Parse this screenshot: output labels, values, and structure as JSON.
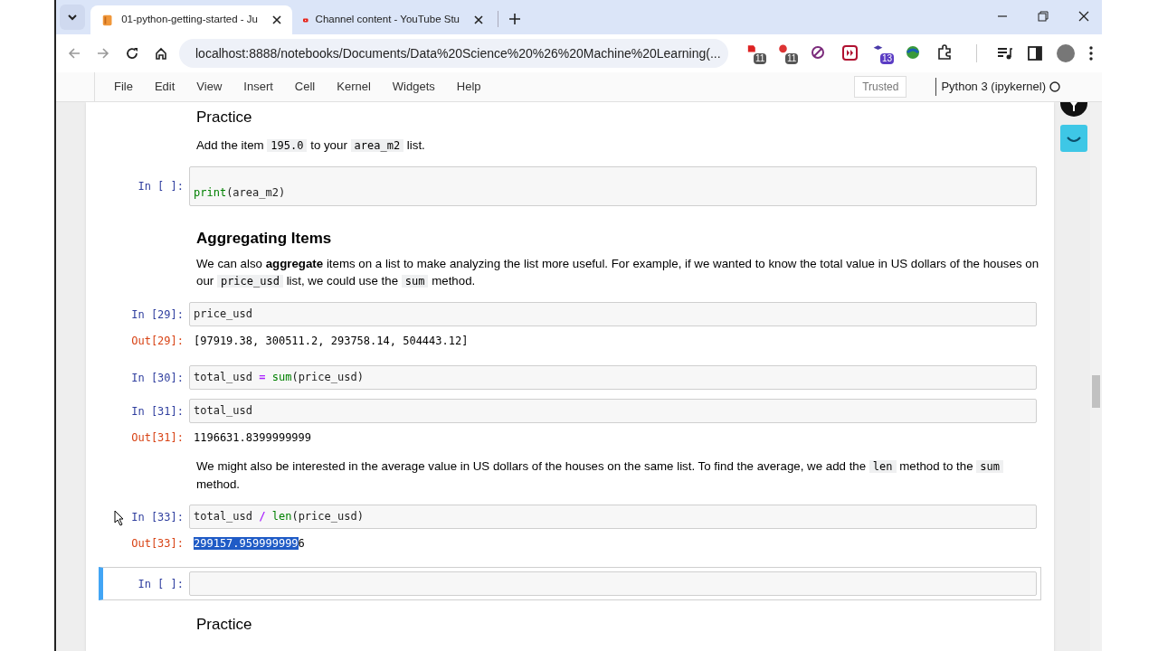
{
  "browser": {
    "tabs": [
      {
        "title": "01-python-getting-started - Ju",
        "kind": "notebook",
        "selected": true
      },
      {
        "title": "Channel content - YouTube Stu",
        "kind": "video",
        "selected": false
      }
    ],
    "url": "localhost:8888/notebooks/Documents/Data%20Science%20%26%20Machine%20Learning(...",
    "extension_badges": [
      "11",
      "11",
      "13"
    ]
  },
  "menu": {
    "items": [
      "File",
      "Edit",
      "View",
      "Insert",
      "Cell",
      "Kernel",
      "Widgets",
      "Help"
    ],
    "trusted": "Trusted",
    "kernel": "Python 3 (ipykernel)"
  },
  "cells": [
    {
      "kind": "subheading",
      "text": "Practice"
    },
    {
      "kind": "markdown",
      "segments": [
        {
          "kind": "text",
          "text": "Add the item"
        },
        {
          "kind": "code",
          "text": "195.0"
        },
        {
          "kind": "text",
          "text": "to your"
        },
        {
          "kind": "code",
          "text": "area_m2"
        },
        {
          "kind": "text",
          "text": "list."
        }
      ]
    },
    {
      "kind": "code",
      "prompt": "In [ ]:",
      "selected": false,
      "blank_first_line": true,
      "lines": [
        [
          {
            "kind": "builtin",
            "text": "print"
          },
          {
            "kind": "name",
            "text": "(area_m2)"
          }
        ]
      ]
    },
    {
      "kind": "heading",
      "text": "Aggregating Items"
    },
    {
      "kind": "markdown",
      "segments": [
        {
          "kind": "text",
          "text": "We can also"
        },
        {
          "kind": "bold",
          "text": "aggregate"
        },
        {
          "kind": "text",
          "text": "items on a list to make analyzing the list more useful. For example, if we wanted to know the total value in US dollars of the houses on our"
        },
        {
          "kind": "code",
          "text": "price_usd"
        },
        {
          "kind": "text",
          "text": "list, we could use the"
        },
        {
          "kind": "code",
          "text": "sum"
        },
        {
          "kind": "text",
          "text": "method."
        }
      ]
    },
    {
      "kind": "code",
      "prompt": "In [29]:",
      "selected": false,
      "lines": [
        [
          {
            "kind": "name",
            "text": "price_usd"
          }
        ]
      ],
      "output": {
        "prompt": "Out[29]:",
        "text": "[97919.38, 300511.2, 293758.14, 504443.12]"
      }
    },
    {
      "kind": "code",
      "prompt": "In [30]:",
      "selected": false,
      "lines": [
        [
          {
            "kind": "name",
            "text": "total_usd"
          },
          {
            "kind": "operator",
            "text": " = "
          },
          {
            "kind": "builtin",
            "text": "sum"
          },
          {
            "kind": "name",
            "text": "(price_usd)"
          }
        ]
      ]
    },
    {
      "kind": "code",
      "prompt": "In [31]:",
      "selected": false,
      "lines": [
        [
          {
            "kind": "name",
            "text": "total_usd"
          }
        ]
      ],
      "output": {
        "prompt": "Out[31]:",
        "text": "1196631.8399999999"
      }
    },
    {
      "kind": "markdown",
      "segments": [
        {
          "kind": "text",
          "text": "We might also be interested in the average value in US dollars of the houses on the same list. To find the average, we add the"
        },
        {
          "kind": "code",
          "text": "len"
        },
        {
          "kind": "text",
          "text": "method to the"
        },
        {
          "kind": "code",
          "text": "sum"
        },
        {
          "kind": "text",
          "text": "method."
        }
      ]
    },
    {
      "kind": "code",
      "prompt": "In [33]:",
      "selected": false,
      "pointer": true,
      "lines": [
        [
          {
            "kind": "name",
            "text": "total_usd"
          },
          {
            "kind": "operator",
            "text": " / "
          },
          {
            "kind": "builtin",
            "text": "len"
          },
          {
            "kind": "name",
            "text": "(price_usd)"
          }
        ]
      ],
      "output": {
        "prompt": "Out[33]:",
        "selected_text": "299157.959999999",
        "text": "6"
      }
    },
    {
      "kind": "code",
      "prompt": "In [ ]:",
      "selected": true
    },
    {
      "kind": "subheading",
      "text": "Practice"
    }
  ]
}
